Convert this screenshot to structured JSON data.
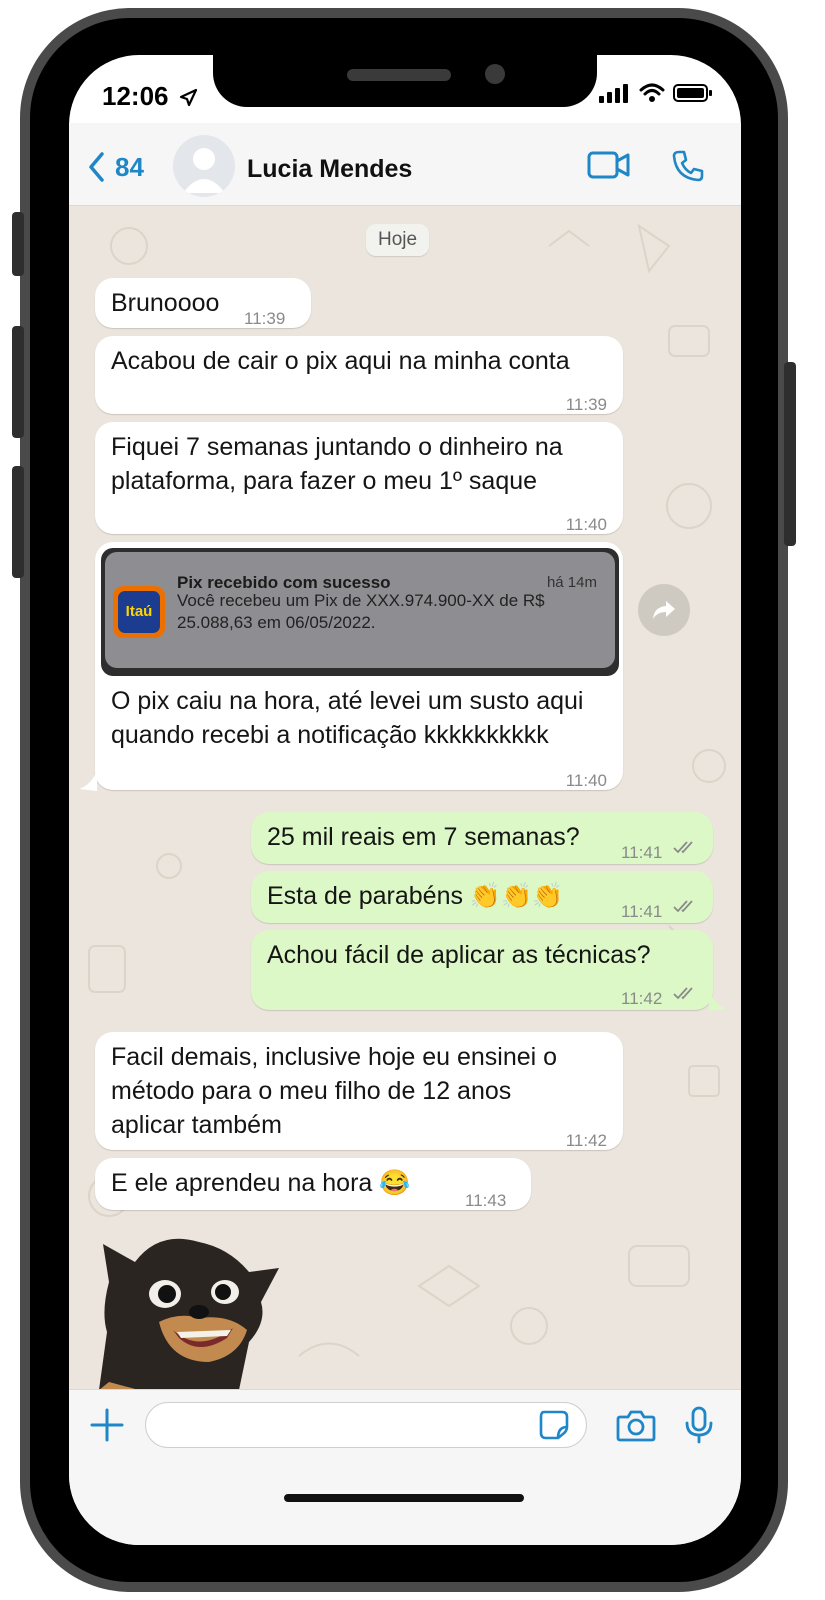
{
  "status_bar": {
    "time": "12:06"
  },
  "header": {
    "back_count": "84",
    "contact_name": "Lucia Mendes"
  },
  "date_separator": "Hoje",
  "messages": [
    {
      "dir": "in",
      "text": "Brunoooo",
      "time": "11:39"
    },
    {
      "dir": "in",
      "text": "Acabou de cair o pix aqui na minha conta",
      "time": "11:39"
    },
    {
      "dir": "in",
      "text": "Fiquei 7 semanas juntando o dinheiro na plataforma, para fazer o meu 1º saque",
      "time": "11:40"
    },
    {
      "dir": "in",
      "text": "O pix caiu na hora, até levei um susto aqui quando recebi a notificação kkkkkkkkkk",
      "time": "11:40"
    },
    {
      "dir": "out",
      "text": "25 mil reais em 7 semanas?",
      "time": "11:41"
    },
    {
      "dir": "out",
      "text": "Esta de parabéns 👏👏👏",
      "time": "11:41"
    },
    {
      "dir": "out",
      "text": "Achou fácil de aplicar as técnicas?",
      "time": "11:42"
    },
    {
      "dir": "in",
      "text": "Facil demais, inclusive hoje eu ensinei o método para o meu filho de 12 anos aplicar também",
      "time": "11:42"
    },
    {
      "dir": "in",
      "text": "E ele aprendeu na hora 😂",
      "time": "11:43"
    }
  ],
  "notification": {
    "bank_logo": "Itaú",
    "title": "Pix recebido com sucesso",
    "ago": "há 14m",
    "body": "Você recebeu um Pix de XXX.974.900-XX de R$ 25.088,63 em 06/05/2022."
  },
  "colors": {
    "accent": "#1f86c8",
    "incoming_bubble": "#ffffff",
    "outgoing_bubble": "#dcf8c6",
    "chat_background": "#ece5dd",
    "read_ticks": "#8a8a8a"
  },
  "icons": {
    "back": "chevron-left-icon",
    "video_call": "video-camera-icon",
    "voice_call": "phone-icon",
    "attach": "plus-icon",
    "sticker": "sticker-icon",
    "camera": "camera-icon",
    "microphone": "microphone-icon",
    "share": "share-arrow-icon"
  }
}
